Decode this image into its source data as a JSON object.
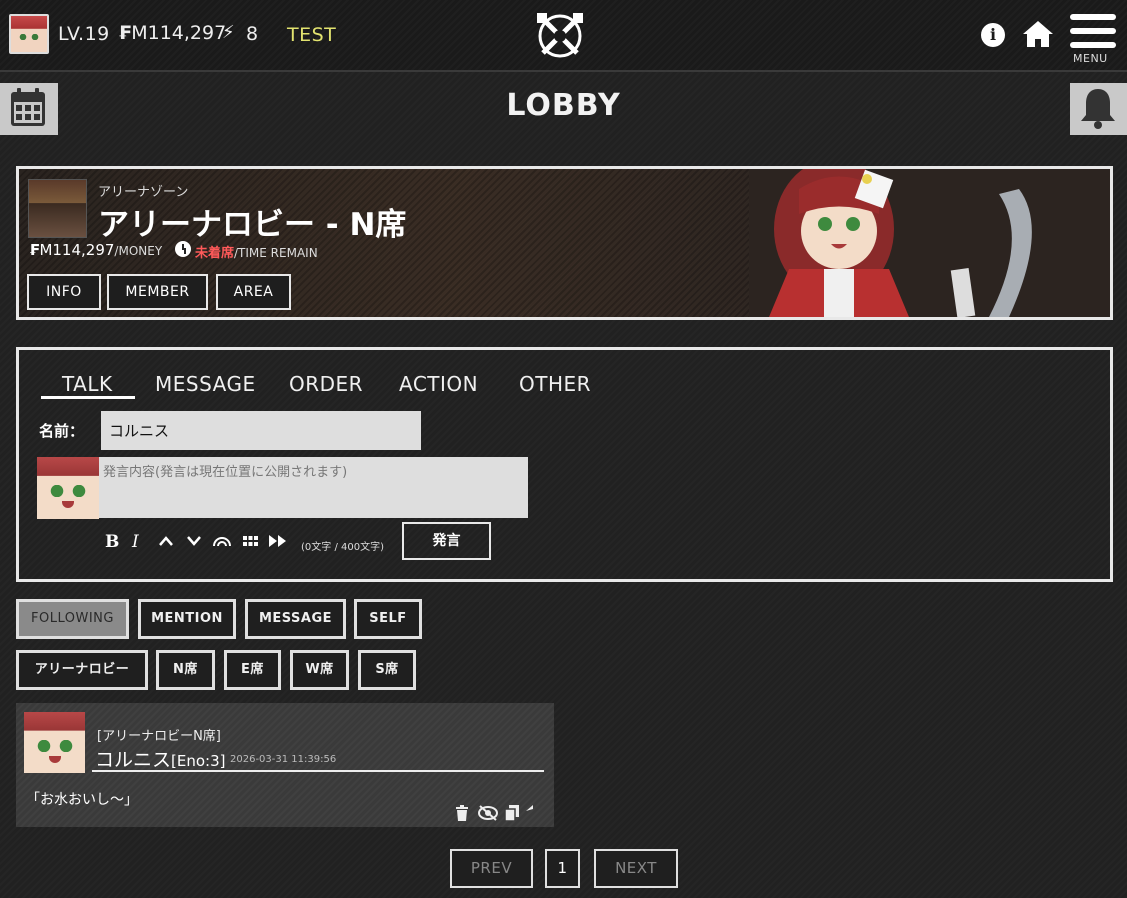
{
  "topbar": {
    "level": "LV.19",
    "money_symbol": "₣",
    "money": "M114,297",
    "bolt_count": "8",
    "test_label": "TEST",
    "menu_label": "MENU"
  },
  "page": {
    "title": "LOBBY"
  },
  "area": {
    "subtitle": "アリーナゾーン",
    "name": "アリーナロビー - N席",
    "money": "M114,297",
    "money_suffix": "/MONEY",
    "time_status": "未着席",
    "time_suffix": "/TIME REMAIN",
    "buttons": [
      "INFO",
      "MEMBER",
      "AREA"
    ]
  },
  "talk": {
    "tabs": [
      "TALK",
      "MESSAGE",
      "ORDER",
      "ACTION",
      "OTHER"
    ],
    "active_tab": "TALK",
    "name_label": "名前：",
    "name_value": "コルニス",
    "message_placeholder": "発言内容(発言は現在位置に公開されます)",
    "char_count": "(0文字 / 400文字)",
    "send_label": "発言",
    "format_tools": [
      "bold-icon",
      "italic-icon",
      "caret-up-icon",
      "caret-down-icon",
      "rainbow-icon",
      "grid-icon",
      "fast-forward-icon"
    ]
  },
  "filters": {
    "row1": [
      "FOLLOWING",
      "MENTION",
      "MESSAGE",
      "SELF"
    ],
    "row2": [
      "アリーナロビー",
      "N席",
      "E席",
      "W席",
      "S席"
    ],
    "active": "FOLLOWING"
  },
  "posts": [
    {
      "location": "[アリーナロビーN席]",
      "name": "コルニス",
      "eno": "[Eno:3]",
      "time": "2026-03-31 11:39:56",
      "body": "「お水おいし～」"
    }
  ],
  "pagination": {
    "prev": "PREV",
    "page": "1",
    "next": "NEXT"
  },
  "colors": {
    "accent_yellow": "#e2e36f",
    "status_red": "#ff5a5a",
    "background": "#212121"
  }
}
